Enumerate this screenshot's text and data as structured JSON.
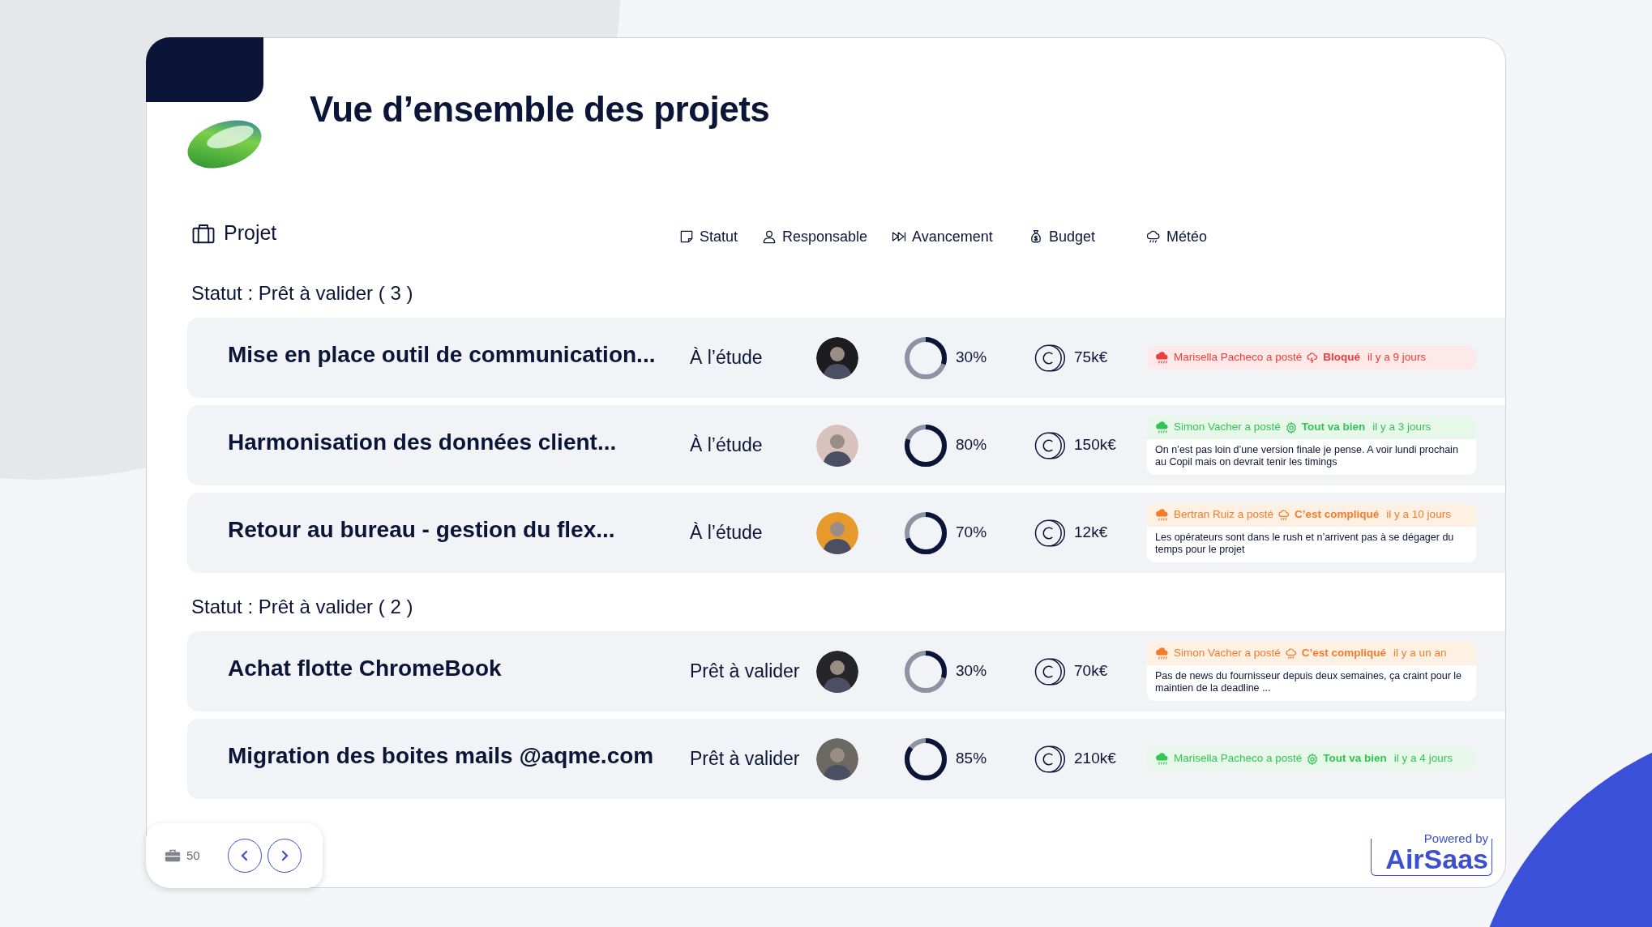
{
  "title": "Vue d’ensemble des projets",
  "columns": {
    "project": "Projet",
    "headers": [
      {
        "kind": "status",
        "label": "Statut"
      },
      {
        "kind": "owner",
        "label": "Responsable"
      },
      {
        "kind": "progress",
        "label": "Avancement"
      },
      {
        "kind": "budget",
        "label": "Budget"
      },
      {
        "kind": "weather",
        "label": "Météo"
      }
    ]
  },
  "groups": [
    {
      "label": "Statut : Prêt à valider ( 3 )",
      "projects": [
        {
          "name": "Mise en place outil de communication...",
          "status": "À l’étude",
          "progress": {
            "level": 0.3
          },
          "progress_text": "30%",
          "budget": "75k€",
          "weather": {
            "kind": "blocked",
            "author": "Marisella Pacheco a posté",
            "mood": "Bloqué",
            "time": "il y a 9 jours"
          }
        },
        {
          "name": "Harmonisation des données client...",
          "status": "À l’étude",
          "progress": {
            "level": 0.8
          },
          "progress_text": "80%",
          "budget": "150k€",
          "weather": {
            "kind": "good",
            "author": "Simon Vacher a posté",
            "mood": "Tout va bien",
            "time": "il y a 3 jours",
            "comment": "On n’est pas loin d’une version finale je pense. A voir lundi prochain au Copil mais on devrait tenir les timings"
          }
        },
        {
          "name": "Retour au bureau - gestion du flex...",
          "status": "À l’étude",
          "progress": {
            "level": 0.7
          },
          "progress_text": "70%",
          "budget": "12k€",
          "weather": {
            "kind": "complicated",
            "author": "Bertran Ruiz a posté",
            "mood": "C’est compliqué",
            "time": "il y a 10 jours",
            "comment": "Les opérateurs sont dans le rush et n’arrivent pas à se dégager du temps pour le projet"
          }
        }
      ]
    },
    {
      "label": "Statut : Prêt à valider ( 2 )",
      "projects": [
        {
          "name": "Achat flotte ChromeBook",
          "status": "Prêt à valider",
          "progress": {
            "level": 0.3
          },
          "progress_text": "30%",
          "budget": "70k€",
          "weather": {
            "kind": "complicated",
            "author": "Simon Vacher a posté",
            "mood": "C’est compliqué",
            "time": "il y a un an",
            "comment": "Pas de news du fournisseur depuis deux semaines, ça craint pour le maintien de la deadline ..."
          }
        },
        {
          "name": "Migration des boites mails @aqme.com",
          "status": "Prêt à valider",
          "progress": {
            "level": 0.85
          },
          "progress_text": "85%",
          "budget": "210k€",
          "weather": {
            "kind": "good",
            "author": "Marisella Pacheco a posté",
            "mood": "Tout va bien",
            "time": "il y a 4 jours"
          }
        }
      ]
    }
  ],
  "pagination": {
    "count": "50"
  },
  "branding": {
    "tagline": "Powered by",
    "name": "AirSaas"
  }
}
